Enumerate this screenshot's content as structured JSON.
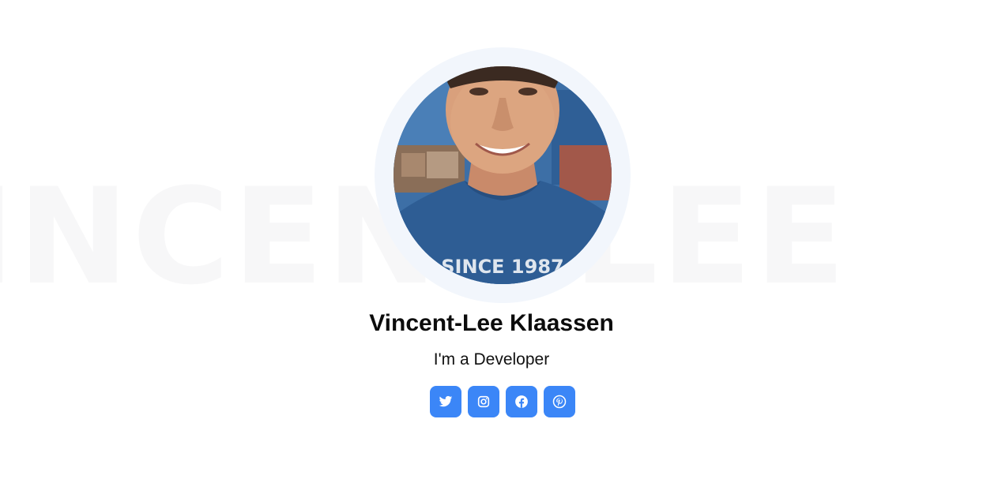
{
  "hero": {
    "background_text": "VINCENT-LEE",
    "name": "Vincent-Lee Klaassen",
    "role": "I'm a Developer",
    "avatar_shirt_text": "SINCE 1987"
  },
  "socials": [
    {
      "icon": "twitter-icon",
      "color": "#3b86f7"
    },
    {
      "icon": "instagram-icon",
      "color": "#3b86f7"
    },
    {
      "icon": "facebook-icon",
      "color": "#3b86f7"
    },
    {
      "icon": "pinterest-icon",
      "color": "#3b86f7"
    }
  ],
  "colors": {
    "accent": "#3b86f7",
    "avatar_ring": "#f2f6fc",
    "background_text": "#f7f7f8"
  }
}
